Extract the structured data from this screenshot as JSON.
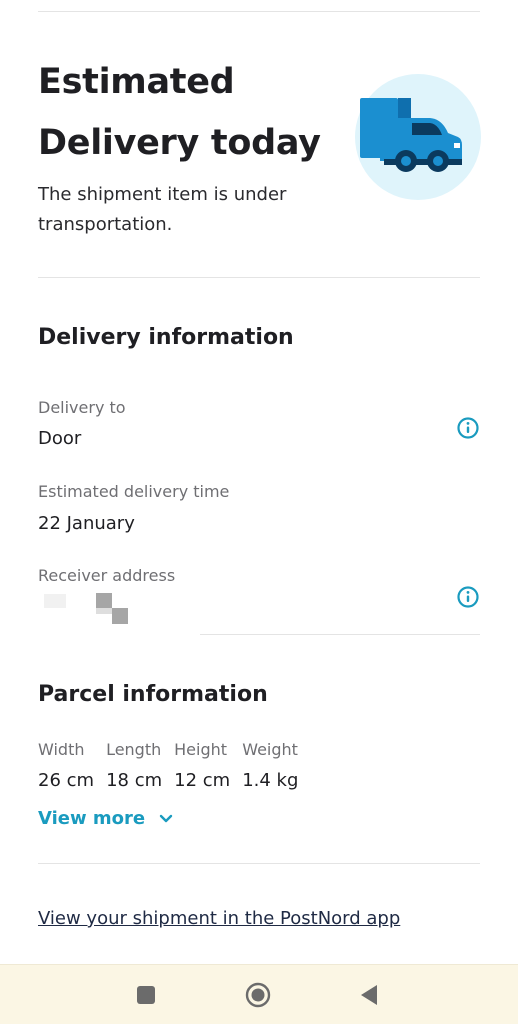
{
  "hero": {
    "title_line1": "Estimated",
    "title_line2": "Delivery today",
    "subtitle_line1": "The shipment item is under",
    "subtitle_line2": "transportation."
  },
  "delivery": {
    "title": "Delivery information",
    "delivery_to_label": "Delivery to",
    "delivery_to_value": "Door",
    "time_label": "Estimated delivery time",
    "time_value": "22 January",
    "address_label": "Receiver address"
  },
  "parcel": {
    "title": "Parcel information",
    "dimensions": [
      {
        "label": "Width",
        "value": "26 cm"
      },
      {
        "label": "Length",
        "value": "18 cm"
      },
      {
        "label": "Height",
        "value": "12 cm"
      },
      {
        "label": "Weight",
        "value": "1.4 kg"
      }
    ],
    "view_more": "View more"
  },
  "footer_link": "View your shipment in the PostNord app",
  "icons": {
    "truck": "delivery-truck-icon",
    "info": "info-icon",
    "chevron": "chevron-down-icon",
    "nav": [
      "recent-apps-icon",
      "home-icon",
      "back-icon"
    ]
  },
  "colors": {
    "accent": "#1a9bbf",
    "truck_bg": "#dff4fb",
    "truck_blue": "#1b8fd0",
    "truck_dark": "#0b3a5e",
    "navbar_bg": "#fbf6e4"
  }
}
